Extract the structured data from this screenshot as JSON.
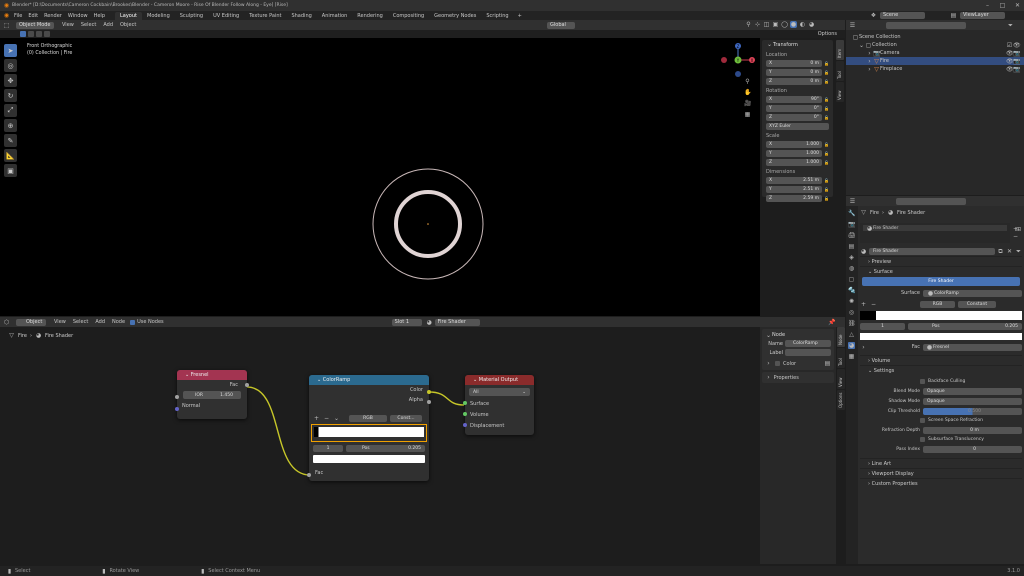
{
  "window": {
    "title": "Blender* [D:\\Documents\\Cameron Cockbain\\Brookes\\Blender - Cameron Moore - Rise Of Blender Follow Along - Eye] [Rise]"
  },
  "menu": {
    "items": [
      "File",
      "Edit",
      "Render",
      "Window",
      "Help"
    ],
    "workspaces": [
      "Layout",
      "Modeling",
      "Sculpting",
      "UV Editing",
      "Texture Paint",
      "Shading",
      "Animation",
      "Rendering",
      "Compositing",
      "Geometry Nodes",
      "Scripting"
    ],
    "active_workspace": "Layout",
    "scene_label": "Scene",
    "view_layer_label": "ViewLayer"
  },
  "viewport": {
    "mode": "Object Mode",
    "menus": [
      "View",
      "Select",
      "Add",
      "Object"
    ],
    "transform_orientation": "Global",
    "options_label": "Options",
    "overlay_line1": "Front Orthographic",
    "overlay_line2": "(0) Collection | Fire",
    "gizmo": {
      "x": "X",
      "y": "Y",
      "z": "Z"
    }
  },
  "npanel": {
    "title": "Transform",
    "location_label": "Location",
    "location": [
      {
        "axis": "X",
        "value": "0 m"
      },
      {
        "axis": "Y",
        "value": "0 m"
      },
      {
        "axis": "Z",
        "value": "0 m"
      }
    ],
    "rotation_label": "Rotation",
    "rotation": [
      {
        "axis": "X",
        "value": "90°"
      },
      {
        "axis": "Y",
        "value": "0°"
      },
      {
        "axis": "Z",
        "value": "0°"
      }
    ],
    "rotation_mode": "XYZ Euler",
    "scale_label": "Scale",
    "scale": [
      {
        "axis": "X",
        "value": "1.000"
      },
      {
        "axis": "Y",
        "value": "1.000"
      },
      {
        "axis": "Z",
        "value": "1.000"
      }
    ],
    "dimensions_label": "Dimensions",
    "dimensions": [
      {
        "axis": "X",
        "value": "2.51 m"
      },
      {
        "axis": "Y",
        "value": "2.51 m"
      },
      {
        "axis": "Z",
        "value": "2.59 m"
      }
    ],
    "tabs": [
      "Item",
      "Tool",
      "View"
    ]
  },
  "outliner": {
    "search_placeholder": "",
    "root": "Scene Collection",
    "collection": "Collection",
    "items": [
      "Camera",
      "Fire",
      "Fireplace"
    ],
    "selected": "Fire"
  },
  "node_editor": {
    "mode": "Object",
    "menus": [
      "View",
      "Select",
      "Add",
      "Node"
    ],
    "use_nodes": "Use Nodes",
    "slot": "Slot 1",
    "material": "Fire Shader",
    "breadcrumb": [
      "Fire",
      "Fire Shader"
    ],
    "fresnel": {
      "title": "Fresnel",
      "output": "Fac",
      "ior_label": "IOR",
      "ior_value": "1.450",
      "normal": "Normal"
    },
    "colorramp": {
      "title": "ColorRamp",
      "out_color": "Color",
      "out_alpha": "Alpha",
      "mode": "RGB",
      "interp": "Const...",
      "stop_index": "1",
      "pos_label": "Pos",
      "pos_value": "0.205",
      "input": "Fac"
    },
    "material_output": {
      "title": "Material Output",
      "target": "All",
      "inputs": [
        "Surface",
        "Volume",
        "Displacement"
      ]
    },
    "side_panel": {
      "title": "Node",
      "name_label": "Name",
      "name_value": "ColorRamp",
      "label_label": "Label",
      "color_label": "Color",
      "properties_label": "Properties",
      "tabs": [
        "Node",
        "Tool",
        "View",
        "Options"
      ]
    }
  },
  "properties": {
    "object": "Fire",
    "material": "Fire Shader",
    "slot_name": "Fire Shader",
    "sections": {
      "preview": "Preview",
      "surface": "Surface",
      "volume": "Volume",
      "settings": "Settings",
      "line_art": "Line Art",
      "viewport_display": "Viewport Display",
      "custom_props": "Custom Properties"
    },
    "surface_type": "Fire Shader",
    "surface_label": "Surface",
    "surface_value": "ColorRamp",
    "ramp_mode": "RGB",
    "ramp_interp": "Constant",
    "ramp_index": "1",
    "ramp_pos_label": "Pos",
    "ramp_pos_value": "0.205",
    "ramp_fac_label": "Fac",
    "ramp_fac_value": "Fresnel",
    "backface_culling": "Backface Culling",
    "blend_mode_label": "Blend Mode",
    "blend_mode": "Opaque",
    "shadow_mode_label": "Shadow Mode",
    "shadow_mode": "Opaque",
    "clip_threshold_label": "Clip Threshold",
    "clip_threshold": "0.500",
    "screen_space_refraction": "Screen Space Refraction",
    "refraction_depth_label": "Refraction Depth",
    "refraction_depth": "0 m",
    "subsurface_translucency": "Subsurface Translucency",
    "pass_index_label": "Pass Index",
    "pass_index": "0"
  },
  "statusbar": {
    "select": "Select",
    "rotate": "Rotate View",
    "context": "Select Context Menu",
    "version": "3.1.0"
  },
  "colors": {
    "accent": "#4772b3",
    "fresnel_header": "#a33451",
    "colorramp_header": "#2b6a8f",
    "output_header": "#8a2b2b",
    "selected_node": "#f0a000",
    "socket_yellow": "#c7c729",
    "socket_green": "#63c763",
    "socket_gray": "#a1a1a1",
    "socket_purple": "#6363c7"
  }
}
